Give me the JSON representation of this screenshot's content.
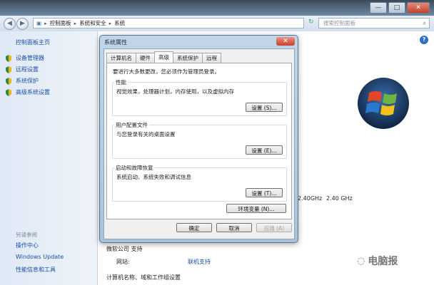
{
  "window": {
    "minimize_glyph": "—",
    "maximize_glyph": "□",
    "close_glyph": "✕"
  },
  "address": {
    "crumbs": [
      "控制面板",
      "系统和安全",
      "系统"
    ],
    "search_placeholder": "搜索控制面板"
  },
  "left_pane": {
    "home": "控制面板主页",
    "items": [
      "设备管理器",
      "远程设置",
      "系统保护",
      "高级系统设置"
    ],
    "see_also_heading": "另请参阅",
    "see_also": [
      "操作中心",
      "Windows Update",
      "性能信息和工具"
    ]
  },
  "main": {
    "cpu_speed_1": "2.40GHz",
    "cpu_speed_2": "2.40 GHz",
    "support_heading": "微软公司 支持",
    "website_label": "网站:",
    "website_link": "联机支持",
    "computer_name_heading": "计算机名称、域和工作组设置"
  },
  "dialog": {
    "title": "系统属性",
    "close_glyph": "✕",
    "tabs": [
      "计算机名",
      "硬件",
      "高级",
      "系统保护",
      "远程"
    ],
    "active_tab": "高级",
    "admin_note": "要进行大多数更改，您必须作为管理员登录。",
    "groups": [
      {
        "title": "性能",
        "desc": "视觉效果，处理器计划，内存使用，以及虚拟内存",
        "button": "设置 (S)..."
      },
      {
        "title": "用户配置文件",
        "desc": "与您登录有关的桌面设置",
        "button": "设置 (E)..."
      },
      {
        "title": "启动和故障恢复",
        "desc": "系统启动、系统失败和调试信息",
        "button": "设置 (T)..."
      }
    ],
    "env_button": "环境变量 (N)...",
    "ok": "确定",
    "cancel": "取消",
    "apply": "应用 (A)"
  },
  "watermark": {
    "text": "电脑报"
  },
  "colors": {
    "link": "#1d50a8",
    "logo_red": "#e2452a",
    "logo_green": "#6cb33f",
    "logo_blue": "#2a78d0",
    "logo_yellow": "#f5c21b"
  }
}
